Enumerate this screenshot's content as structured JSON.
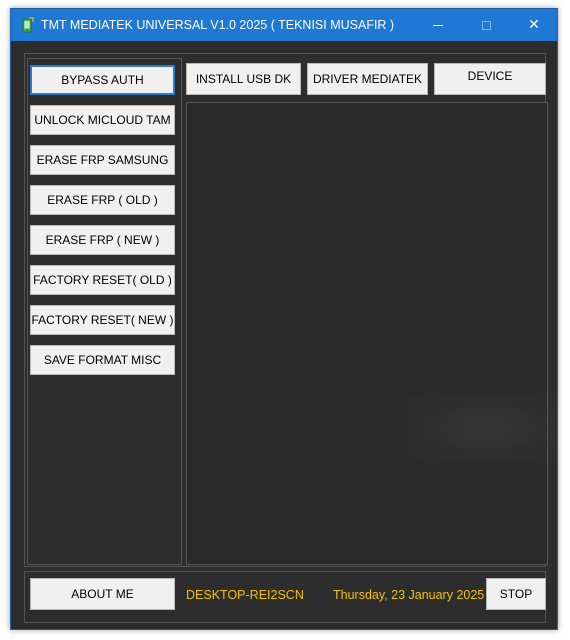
{
  "window": {
    "title": "TMT MEDIATEK UNIVERSAL V1.0 2025 ( TEKNISI MUSAFIR )",
    "icons": {
      "app": "green-phone-icon",
      "minimize": "minimize-icon",
      "maximize": "maximize-icon",
      "close": "close-icon"
    },
    "close_glyph": "✕"
  },
  "left_menu": [
    {
      "label": "BYPASS AUTH",
      "selected": true
    },
    {
      "label": "UNLOCK MICLOUD TAM"
    },
    {
      "label": "ERASE FRP SAMSUNG"
    },
    {
      "label": "ERASE FRP ( OLD )"
    },
    {
      "label": "ERASE FRP ( NEW )"
    },
    {
      "label": "FACTORY RESET( OLD )"
    },
    {
      "label": "FACTORY RESET( NEW )"
    },
    {
      "label": "SAVE FORMAT MISC"
    }
  ],
  "toolbar": {
    "install_usb_dk": "INSTALL USB DK",
    "driver_mediatek": "DRIVER MEDIATEK",
    "device": "DEVICE"
  },
  "footer": {
    "about_me": "ABOUT ME",
    "computer_name": "DESKTOP-REI2SCN",
    "date": "Thursday, 23 January 2025",
    "stop": "STOP"
  },
  "colors": {
    "titlebar": "#1e78d4",
    "background": "#2d2d2d",
    "info_text": "#f2c200",
    "selected_border": "#2b78d0"
  }
}
